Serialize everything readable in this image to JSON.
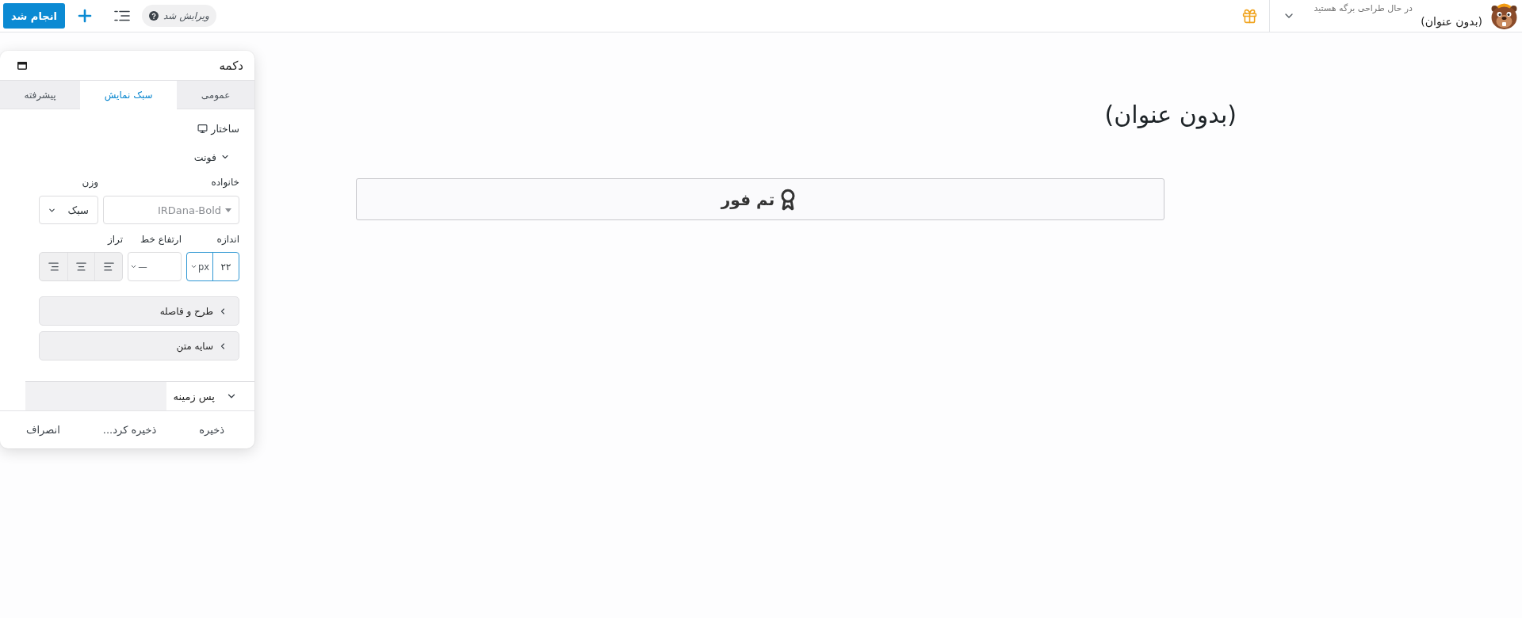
{
  "top_bar": {
    "page_status": "در حال طراحی برگه هستید",
    "page_title": "(بدون عنوان)",
    "edit_status": "ویرایش شد",
    "done_button": "انجام شد"
  },
  "panel": {
    "title": "دکمه",
    "tabs": [
      {
        "label": "عمومی",
        "selected": false
      },
      {
        "label": "سبک نمایش",
        "selected": true
      },
      {
        "label": "پیشرفته",
        "selected": false
      }
    ],
    "structure_label": "ساختار",
    "font_section": {
      "label": "فونت",
      "expanded": true,
      "family": {
        "label": "خانواده",
        "placeholder": "IRDana-Bold"
      },
      "weight": {
        "label": "وزن",
        "value": "سبک"
      },
      "size": {
        "label": "اندازه",
        "value": "۲۲",
        "unit": "px"
      },
      "line_height": {
        "label": "ارتفاع خط",
        "unit": "—"
      },
      "alignment": {
        "label": "تراز",
        "options": [
          {
            "kind": "left",
            "selected": false
          },
          {
            "kind": "center",
            "selected": false
          },
          {
            "kind": "right",
            "selected": false
          }
        ]
      }
    },
    "sub_sections": [
      {
        "label": "طرح و فاصله",
        "expanded": false
      },
      {
        "label": "سایه متن",
        "expanded": false
      }
    ],
    "background_section": {
      "label": "پس زمینه",
      "expanded": true
    },
    "footer_buttons": [
      "ذخیره",
      "ذخیره کرد...",
      "انصراف"
    ]
  },
  "page": {
    "title": "(بدون عنوان)",
    "button_label": "تم فور"
  }
}
